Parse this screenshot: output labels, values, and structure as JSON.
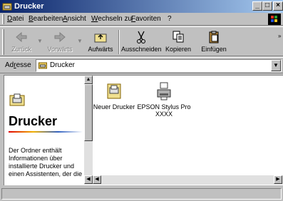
{
  "window": {
    "title": "Drucker"
  },
  "menu": {
    "items": [
      "Datei",
      "Bearbeiten",
      "Ansicht",
      "Wechseln zu",
      "Favoriten",
      "?"
    ]
  },
  "toolbar": {
    "back_label": "Zurück",
    "forward_label": "Vorwärts",
    "up_label": "Aufwärts",
    "cut_label": "Ausschneiden",
    "copy_label": "Kopieren",
    "paste_label": "Einfügen",
    "more_glyph": "»"
  },
  "address": {
    "label_prefix": "Ad",
    "label_underlined": "r",
    "label_suffix": "esse",
    "value": "Drucker"
  },
  "left_pane": {
    "heading": "Drucker",
    "description": "Der Ordner enthält Informationen über installierte Drucker und einen Assistenten, der die"
  },
  "files": [
    {
      "name": "Neuer Drucker",
      "icon": "add-printer-icon"
    },
    {
      "name": "EPSON Stylus Pro XXXX",
      "icon": "printer-icon"
    }
  ],
  "status": {
    "text": ""
  }
}
